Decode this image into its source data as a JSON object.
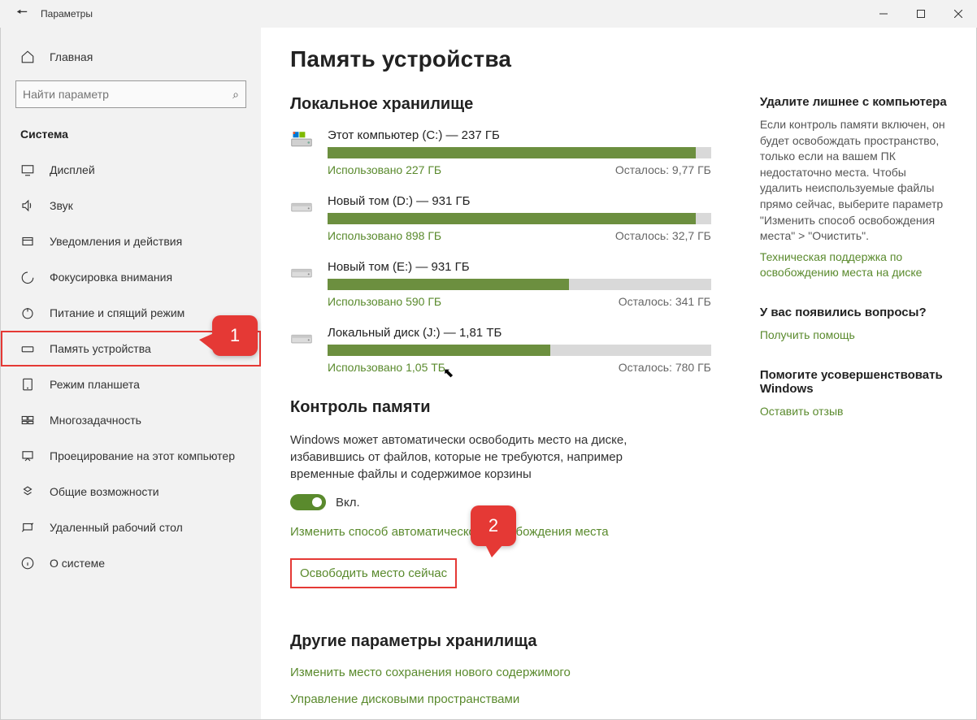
{
  "window": {
    "title": "Параметры"
  },
  "sidebar": {
    "home": "Главная",
    "search_placeholder": "Найти параметр",
    "section": "Система",
    "items": [
      {
        "label": "Дисплей"
      },
      {
        "label": "Звук"
      },
      {
        "label": "Уведомления и действия"
      },
      {
        "label": "Фокусировка внимания"
      },
      {
        "label": "Питание и спящий режим"
      },
      {
        "label": "Память устройства"
      },
      {
        "label": "Режим планшета"
      },
      {
        "label": "Многозадачность"
      },
      {
        "label": "Проецирование на этот компьютер"
      },
      {
        "label": "Общие возможности"
      },
      {
        "label": "Удаленный рабочий стол"
      },
      {
        "label": "О системе"
      }
    ]
  },
  "page": {
    "title": "Память устройства",
    "local_storage_heading": "Локальное хранилище",
    "drives": [
      {
        "name": "Этот компьютер (C:) — 237 ГБ",
        "used_label": "Использовано 227 ГБ",
        "remain_label": "Осталось: 9,77 ГБ",
        "fill_pct": 96,
        "is_system": true
      },
      {
        "name": "Новый том (D:) — 931 ГБ",
        "used_label": "Использовано 898 ГБ",
        "remain_label": "Осталось: 32,7 ГБ",
        "fill_pct": 96,
        "is_system": false
      },
      {
        "name": "Новый том (E:) — 931 ГБ",
        "used_label": "Использовано 590 ГБ",
        "remain_label": "Осталось: 341 ГБ",
        "fill_pct": 63,
        "is_system": false
      },
      {
        "name": "Локальный диск (J:) — 1,81 ТБ",
        "used_label": "Использовано 1,05 ТБ",
        "remain_label": "Осталось: 780 ГБ",
        "fill_pct": 58,
        "is_system": false
      }
    ],
    "sense_heading": "Контроль памяти",
    "sense_text": "Windows может автоматически освободить место на диске, избавившись от файлов, которые не требуются, например временные файлы и содержимое корзины",
    "toggle_label": "Вкл.",
    "change_link": "Изменить способ автоматического освобождения места",
    "free_now_link": "Освободить место сейчас",
    "other_heading": "Другие параметры хранилища",
    "other_links": [
      "Изменить место сохранения нового содержимого",
      "Управление дисковыми пространствами"
    ]
  },
  "aside": {
    "block1_head": "Удалите лишнее с компьютера",
    "block1_text": "Если контроль памяти включен, он будет освобождать пространство, только если на вашем ПК недостаточно места. Чтобы удалить неиспользуемые файлы прямо сейчас, выберите параметр \"Изменить способ освобождения места\" > \"Очистить\".",
    "block1_link": "Техническая поддержка по освобождению места на диске",
    "block2_head": "У вас появились вопросы?",
    "block2_link": "Получить помощь",
    "block3_head": "Помогите усовершенствовать Windows",
    "block3_link": "Оставить отзыв"
  },
  "callouts": {
    "c1": "1",
    "c2": "2"
  }
}
